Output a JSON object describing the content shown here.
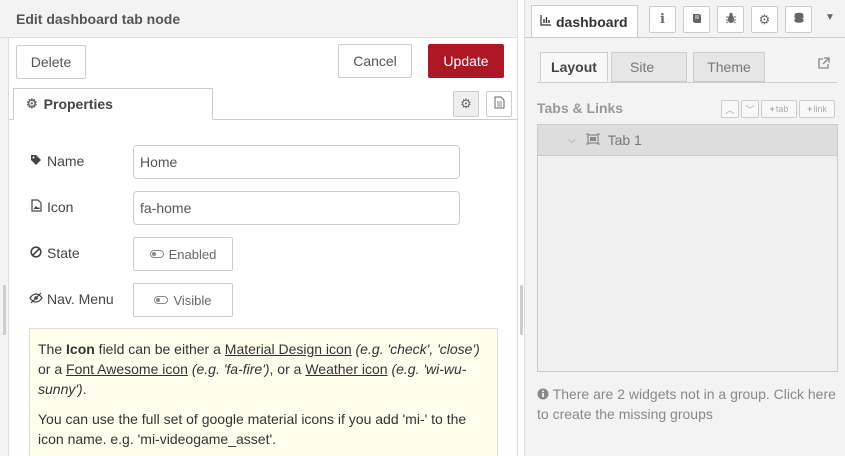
{
  "editor": {
    "title": "Edit dashboard tab node",
    "buttons": {
      "delete": "Delete",
      "cancel": "Cancel",
      "update": "Update"
    },
    "tab_label": "Properties",
    "fields": {
      "name": {
        "label": "Name",
        "value": "Home"
      },
      "icon": {
        "label": "Icon",
        "value": "fa-home"
      },
      "state": {
        "label": "State",
        "toggle": "Enabled"
      },
      "nav": {
        "label": "Nav. Menu",
        "toggle": "Visible"
      }
    },
    "tip": {
      "p1_a": "The ",
      "p1_icon": "Icon",
      "p1_b": " field can be either a ",
      "p1_md": "Material Design icon",
      "p1_md_eg": "(e.g. 'check', 'close')",
      "p1_c": " or a ",
      "p1_fa": "Font Awesome icon",
      "p1_fa_eg": "(e.g. 'fa-fire')",
      "p1_d": ", or a ",
      "p1_wi": "Weather icon",
      "p1_wi_eg": "(e.g. 'wi-wu-sunny')",
      "p1_e": ".",
      "p2": "You can use the full set of google material icons if you add 'mi-' to the icon name. e.g. 'mi-videogame_asset'."
    }
  },
  "sidebar": {
    "active_tab": "dashboard",
    "subtabs": {
      "layout": "Layout",
      "site": "Site",
      "theme": "Theme"
    },
    "section_label": "Tabs & Links",
    "mini_buttons": {
      "tab": "tab",
      "link": "link"
    },
    "tree": [
      {
        "label": "Tab 1"
      }
    ],
    "note": "There are 2 widgets not in a group. Click here to create the missing groups"
  },
  "icons": [
    "gear-icon",
    "file-icon",
    "tag-icon",
    "image-icon",
    "ban-icon",
    "eye-slash-icon",
    "bar-chart-icon",
    "info-icon",
    "book-icon",
    "bug-icon",
    "database-icon",
    "caret-down-icon",
    "external-link-icon",
    "chevron-down-icon",
    "tab-icon",
    "info-circle-icon"
  ],
  "colors": {
    "primary": "#ad1625",
    "tip_background": "#ffffee",
    "panel": "#f3f3f3"
  }
}
